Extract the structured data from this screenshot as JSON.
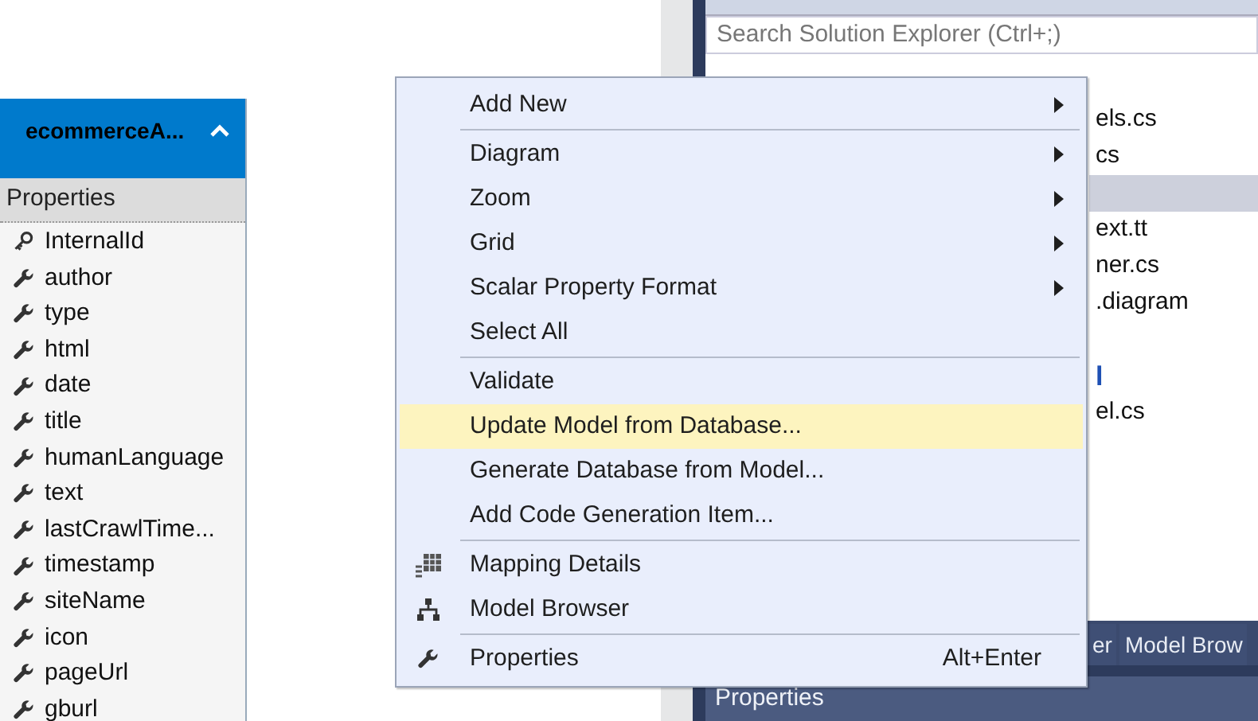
{
  "entity": {
    "title": "ecommerceA...",
    "expanded": true,
    "section": "Properties",
    "properties": [
      {
        "name": "InternalId",
        "kind": "key"
      },
      {
        "name": "author",
        "kind": "scalar"
      },
      {
        "name": "type",
        "kind": "scalar"
      },
      {
        "name": "html",
        "kind": "scalar"
      },
      {
        "name": "date",
        "kind": "scalar"
      },
      {
        "name": "title",
        "kind": "scalar"
      },
      {
        "name": "humanLanguage",
        "kind": "scalar"
      },
      {
        "name": "text",
        "kind": "scalar"
      },
      {
        "name": "lastCrawlTime...",
        "kind": "scalar"
      },
      {
        "name": "timestamp",
        "kind": "scalar"
      },
      {
        "name": "siteName",
        "kind": "scalar"
      },
      {
        "name": "icon",
        "kind": "scalar"
      },
      {
        "name": "pageUrl",
        "kind": "scalar"
      },
      {
        "name": "gburl",
        "kind": "scalar"
      }
    ]
  },
  "solution_explorer": {
    "search": {
      "placeholder": "Search Solution Explorer (Ctrl+;)"
    },
    "items": [
      {
        "label": "els.cs",
        "selected": false
      },
      {
        "label": "cs",
        "selected": false
      },
      {
        "selected": true
      },
      {
        "label": "ext.tt",
        "selected": false
      },
      {
        "label": "ner.cs",
        "selected": false
      },
      {
        "label": ".diagram",
        "selected": false
      },
      {
        "selected": false
      },
      {
        "label": "l",
        "selected": false,
        "color": "#1e50b4"
      },
      {
        "label": "el.cs",
        "selected": false
      }
    ]
  },
  "bottom_tabs": [
    {
      "label": "er",
      "selected": false
    },
    {
      "label": "Model Brow",
      "selected": false
    }
  ],
  "properties_panel": {
    "title": "Properties"
  },
  "context_menu": {
    "items": [
      {
        "kind": "submenu",
        "label": "Add New",
        "selected": false
      },
      {
        "kind": "separator"
      },
      {
        "kind": "submenu",
        "label": "Diagram",
        "selected": false
      },
      {
        "kind": "submenu",
        "label": "Zoom",
        "selected": false
      },
      {
        "kind": "submenu",
        "label": "Grid",
        "selected": false
      },
      {
        "kind": "submenu",
        "label": "Scalar Property Format",
        "selected": false
      },
      {
        "kind": "plain",
        "label": "Select All",
        "selected": false
      },
      {
        "kind": "separator"
      },
      {
        "kind": "plain",
        "label": "Validate",
        "selected": false
      },
      {
        "kind": "plain",
        "label": "Update Model from Database...",
        "selected": true
      },
      {
        "kind": "plain",
        "label": "Generate Database from Model...",
        "selected": false
      },
      {
        "kind": "plain",
        "label": "Add Code Generation Item...",
        "selected": false
      },
      {
        "kind": "separator"
      },
      {
        "kind": "mapping",
        "label": "Mapping Details",
        "selected": false
      },
      {
        "kind": "browser",
        "label": "Model Browser",
        "selected": false
      },
      {
        "kind": "separator"
      },
      {
        "kind": "wrench",
        "label": "Properties",
        "shortcut": "Alt+Enter",
        "selected": false
      }
    ]
  }
}
